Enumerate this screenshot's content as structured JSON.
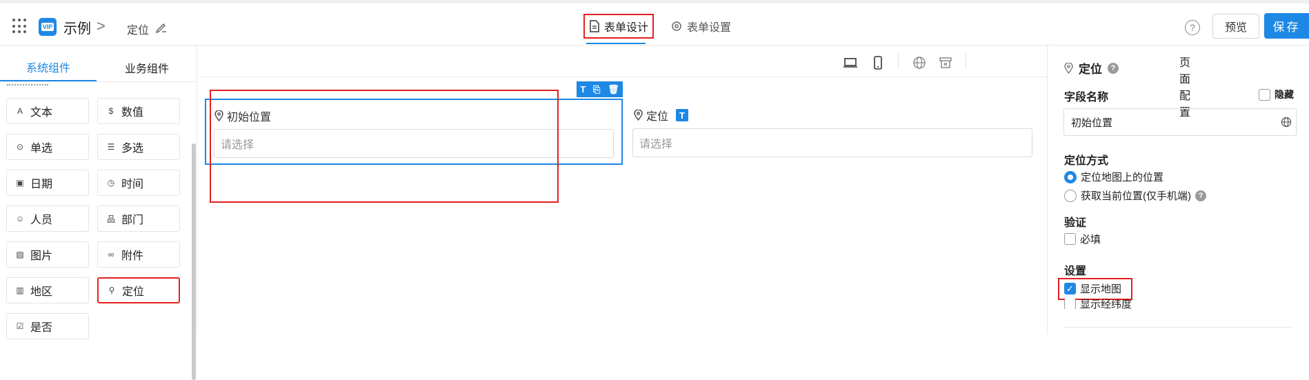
{
  "header": {
    "app_name": "示例",
    "logo_text": "VIP",
    "breadcrumb_sep": ">",
    "page_name": "定位",
    "tabs": [
      {
        "label": "表单设计",
        "active": true
      },
      {
        "label": "表单设置",
        "active": false
      }
    ],
    "help": "?",
    "preview_label": "预览",
    "save_label": "保存"
  },
  "left": {
    "tabs": [
      {
        "label": "系统组件",
        "active": true
      },
      {
        "label": "业务组件",
        "active": false
      }
    ],
    "components": [
      {
        "icon": "text-icon",
        "glyph": "A",
        "label": "文本"
      },
      {
        "icon": "number-icon",
        "glyph": "$",
        "label": "数值"
      },
      {
        "icon": "single-choice-icon",
        "glyph": "⊙",
        "label": "单选"
      },
      {
        "icon": "multi-choice-icon",
        "glyph": "☰",
        "label": "多选"
      },
      {
        "icon": "date-icon",
        "glyph": "▣",
        "label": "日期"
      },
      {
        "icon": "time-icon",
        "glyph": "◷",
        "label": "时间"
      },
      {
        "icon": "person-icon",
        "glyph": "☺",
        "label": "人员"
      },
      {
        "icon": "department-icon",
        "glyph": "品",
        "label": "部门"
      },
      {
        "icon": "image-icon",
        "glyph": "▨",
        "label": "图片"
      },
      {
        "icon": "attachment-icon",
        "glyph": "∞",
        "label": "附件"
      },
      {
        "icon": "region-icon",
        "glyph": "▥",
        "label": "地区"
      },
      {
        "icon": "location-icon",
        "glyph": "⚲",
        "label": "定位"
      },
      {
        "icon": "yes-no-icon",
        "glyph": "☑",
        "label": "是否"
      }
    ]
  },
  "toolbar": {
    "page_config": "页面配置",
    "icons": [
      "desktop-icon",
      "mobile-icon",
      "globe-icon",
      "archive-icon"
    ]
  },
  "canvas": {
    "field1": {
      "label": "初始位置",
      "placeholder": "请选择"
    },
    "field2": {
      "label": "定位",
      "badge": "T",
      "placeholder": "请选择"
    },
    "mini_tools": [
      "T",
      "⎘",
      "🗑"
    ]
  },
  "right": {
    "title": "定位",
    "field_name_title": "字段名称",
    "hidden_label": "隐藏",
    "field_name_value": "初始位置",
    "locate_method_title": "定位方式",
    "locate_options": [
      {
        "label": "定位地图上的位置",
        "selected": true
      },
      {
        "label": "获取当前位置(仅手机端)",
        "selected": false
      }
    ],
    "validate_title": "验证",
    "required_label": "必填",
    "settings_title": "设置",
    "show_map_label": "显示地图",
    "show_map_checked": true,
    "show_latlng_label": "显示经纬度"
  },
  "colors": {
    "accent": "#1e88e5",
    "highlight": "#e31e1e"
  }
}
